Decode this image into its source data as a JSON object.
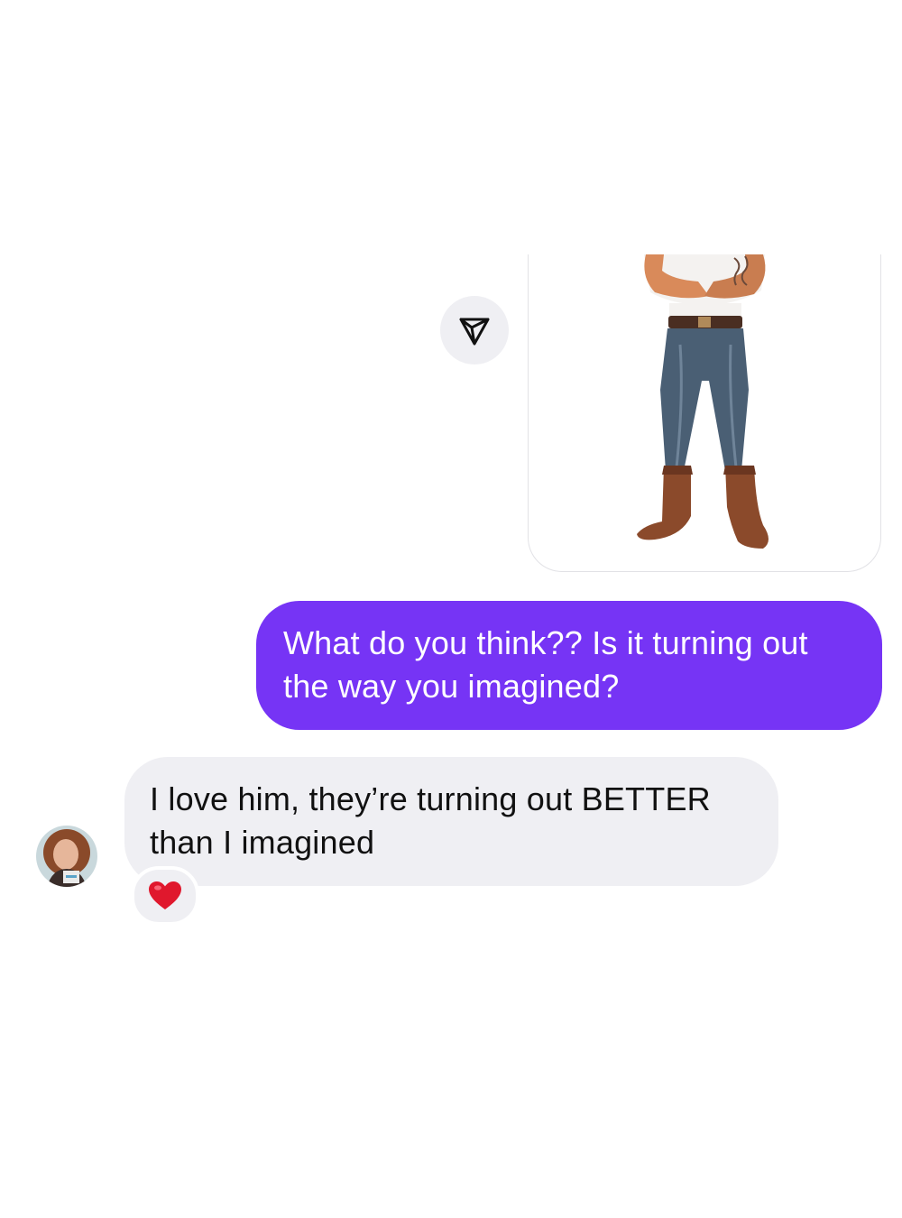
{
  "conversation": {
    "shared_image": {
      "icon": "illustration-cowboy-figure"
    },
    "share_button": {
      "icon": "paper-plane-icon"
    },
    "messages": [
      {
        "sender": "me",
        "text": "What do you think?? Is it turning out the way you imagined?",
        "bubble_color": "#7634f5"
      },
      {
        "sender": "them",
        "text": "I love him, they’re turning out BETTER than I imagined",
        "bubble_color": "#efeff3",
        "reaction": "❤️"
      }
    ],
    "avatar": {
      "icon": "contact-avatar"
    }
  }
}
